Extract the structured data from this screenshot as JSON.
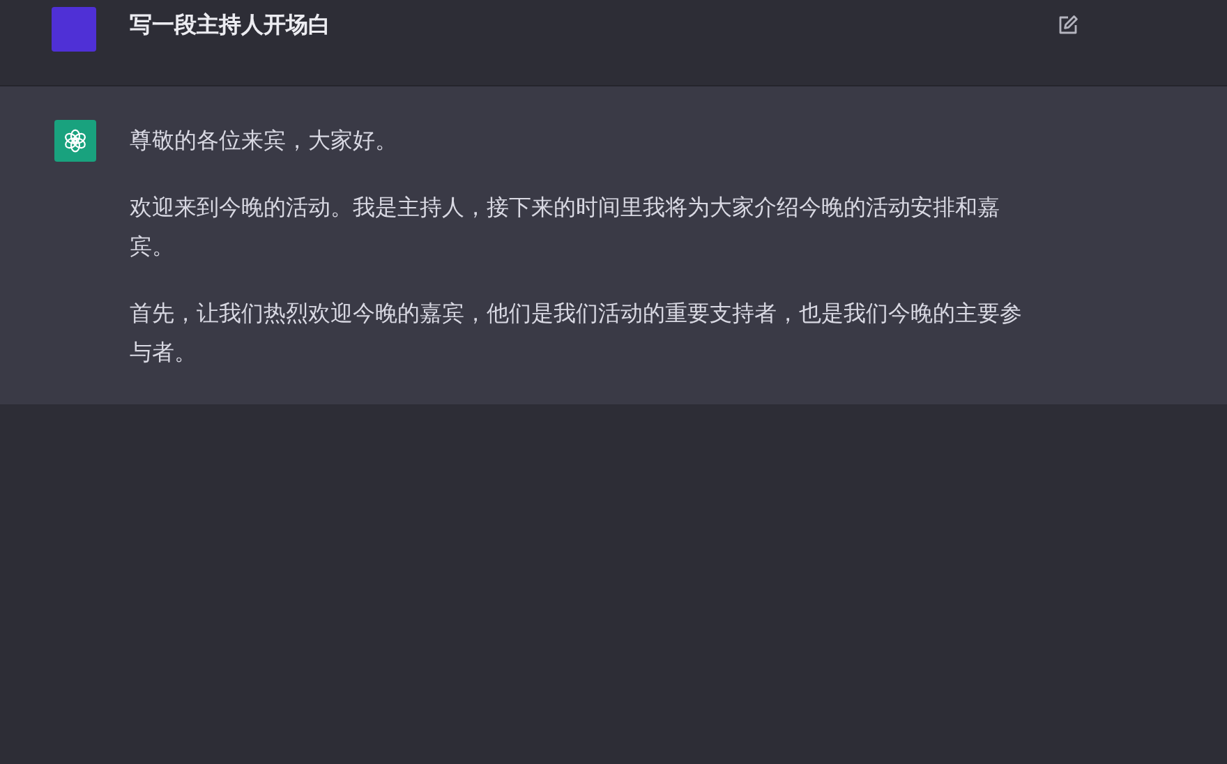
{
  "messages": [
    {
      "kind": "prompt",
      "paragraphs": [
        "写一段主持人开场白"
      ]
    },
    {
      "kind": "reply",
      "paragraphs": [
        "尊敬的各位来宾，大家好。",
        "欢迎来到今晚的活动。我是主持人，接下来的时间里我将为大家介绍今晚的活动安排和嘉宾。",
        "首先，让我们热烈欢迎今晚的嘉宾，他们是我们活动的重要支持者，也是我们今晚的主要参与者。"
      ]
    }
  ]
}
